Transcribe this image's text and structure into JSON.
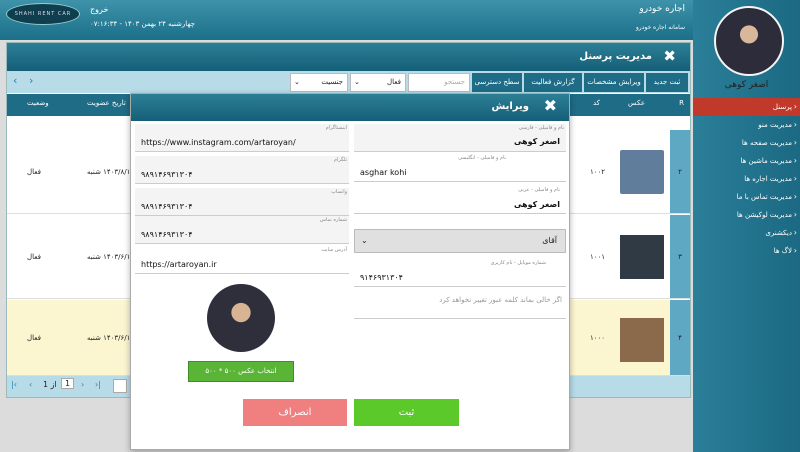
{
  "topbar": {
    "app_title": "اجاره خودرو",
    "app_subtitle": "سامانه اجاره خودرو",
    "logout": "خروج",
    "datetime": "چهارشنبه ۲۴ بهمن ۱۴۰۳ - ۰۷:۱۶:۳۴",
    "logo_text": "SHAHI RENT CAR"
  },
  "sidebar": {
    "user_name": "اصغر کوهی",
    "items": [
      {
        "label": "پرسنل",
        "active": true
      },
      {
        "label": "مدیریت منو"
      },
      {
        "label": "مدیریت صفحه ها"
      },
      {
        "label": "مدیریت ماشین ها"
      },
      {
        "label": "مدیریت اجاره ها"
      },
      {
        "label": "مدیریت تماس با ما"
      },
      {
        "label": "مدیریت لوکیشن ها"
      },
      {
        "label": "دیکشنری"
      },
      {
        "label": "لاگ ها"
      }
    ]
  },
  "main": {
    "title": "مدیریت پرسنل",
    "toolbar": {
      "new": "ثبت جدید",
      "edit_specs": "ویرایش مشخصات",
      "activity_report": "گزارش فعالیت",
      "access_level": "سطح دسترسی",
      "search_placeholder": "جستجو",
      "status_select": "فعال",
      "gender_select": "جنسیت"
    },
    "columns": {
      "row": "R",
      "photo": "عکس",
      "code": "کد",
      "join_date": "تاریخ عضویت",
      "status": "وضعیت"
    },
    "rows": [
      {
        "num": "۲",
        "code": "۱۰۰۲",
        "date": "۱۴۰۳/۸/۱۳ شنبه",
        "status": "فعال"
      },
      {
        "num": "۳",
        "code": "۱۰۰۱",
        "date": "۱۴۰۳/۶/۱۶ شنبه",
        "status": "فعال"
      },
      {
        "num": "۴",
        "code": "۱۰۰۰",
        "date": "۱۴۰۳/۶/۱۶ شنبه",
        "status": "فعال"
      }
    ],
    "pager": {
      "page": "1",
      "of": "از 1"
    }
  },
  "modal": {
    "title": "ویرایش",
    "fields": {
      "name_fa_label": "نام و فامیلی - فارسی",
      "name_fa": "اصغر کوهی",
      "name_en_label": "نام و فامیلی - انگلیسی",
      "name_en": "asghar kohi",
      "name_ar_label": "نام و فامیلی - عربی",
      "name_ar": "اصغر کوهی",
      "title_select": "آقای",
      "mobile_label": "شماره موبایل - نام کاربری",
      "mobile": "۹۱۴۶۹۳۱۳۰۴",
      "password_hint": "اگر خالی بماند کلمه عبور تغییر نخواهد کرد",
      "instagram_label": "اینستاگرام",
      "instagram": "https://www.instagram.com/artaroyan/",
      "telegram_label": "تلگرام",
      "telegram": "۹۸۹۱۴۶۹۳۱۳۰۴",
      "whatsapp_label": "واتساپ",
      "whatsapp": "۹۸۹۱۴۶۹۳۱۳۰۴",
      "phone_label": "شماره تماس",
      "phone": "۹۸۹۱۴۶۹۳۱۳۰۴",
      "website_label": "آدرس سایت",
      "website": "https://artaroyan.ir"
    },
    "pick_photo": "انتخاب عکس ۵۰۰ * ۵۰۰",
    "submit": "ثبت",
    "cancel": "انصراف"
  }
}
